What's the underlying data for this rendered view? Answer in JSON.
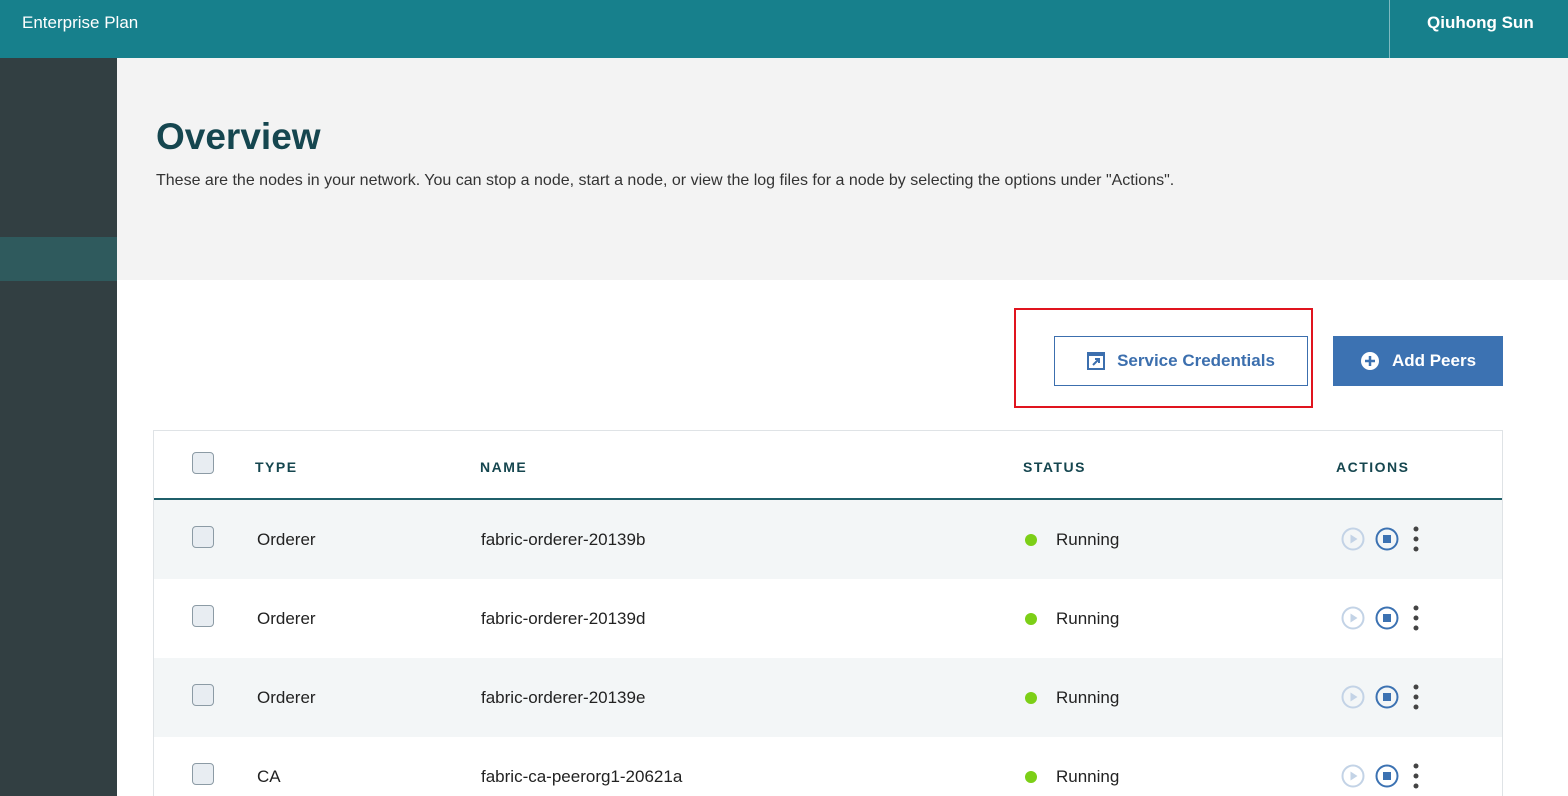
{
  "topbar": {
    "plan_name": "Enterprise Plan",
    "user_name": "Qiuhong Sun",
    "color": "#17808c"
  },
  "page": {
    "title": "Overview",
    "description": "These are the nodes in your network. You can stop a node, start a node, or view the log files for a node by selecting the options under \"Actions\"."
  },
  "buttons": {
    "service_credentials": "Service Credentials",
    "service_credentials_icon": "launch-icon",
    "add_peers": "Add Peers",
    "add_peers_icon": "plus-circle-icon",
    "accent_color": "#3c72b2"
  },
  "table": {
    "headers": {
      "type": "TYPE",
      "name": "NAME",
      "status": "STATUS",
      "actions": "ACTIONS"
    },
    "rows": [
      {
        "type": "Orderer",
        "name": "fabric-orderer-20139b",
        "status": "Running"
      },
      {
        "type": "Orderer",
        "name": "fabric-orderer-20139d",
        "status": "Running"
      },
      {
        "type": "Orderer",
        "name": "fabric-orderer-20139e",
        "status": "Running"
      },
      {
        "type": "CA",
        "name": "fabric-ca-peerorg1-20621a",
        "status": "Running"
      }
    ],
    "action_icons": [
      "play-icon",
      "stop-icon",
      "overflow-menu-icon"
    ],
    "status_color": "#7ccf17"
  }
}
